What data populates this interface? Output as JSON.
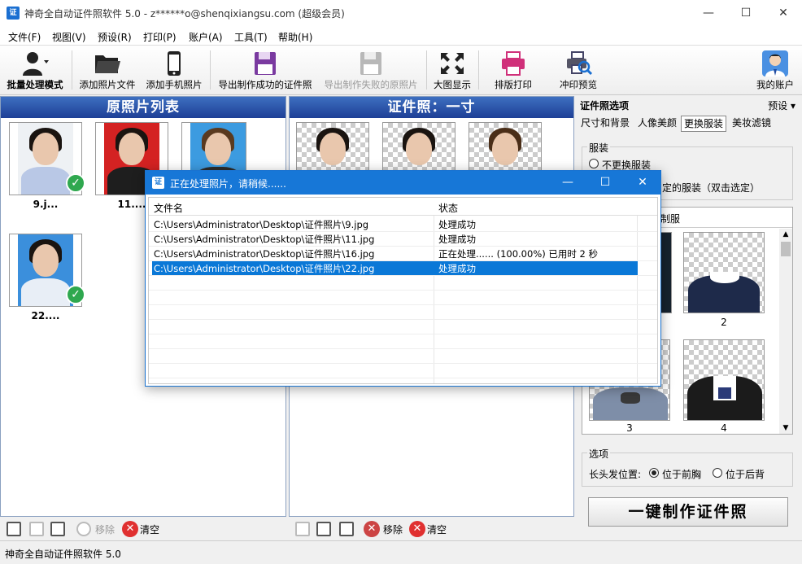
{
  "window": {
    "title": "神奇全自动证件照软件 5.0 - z******o@shenqixiangsu.com (超级会员)",
    "minimize": "—",
    "maximize": "☐",
    "close": "✕"
  },
  "menu": [
    "文件(F)",
    "视图(V)",
    "预设(R)",
    "打印(P)",
    "账户(A)",
    "工具(T)",
    "帮助(H)"
  ],
  "toolbar": {
    "batch": "批量处理模式",
    "add_file": "添加照片文件",
    "add_phone": "添加手机照片",
    "export_success": "导出制作成功的证件照",
    "export_failed": "导出制作失败的原照片",
    "big_view": "大图显示",
    "layout_print": "排版打印",
    "print_preview": "冲印预览",
    "account": "我的账户"
  },
  "left_panel": {
    "title": "原照片列表",
    "photos": [
      "9.j...",
      "11....",
      "22...."
    ],
    "remove": "移除",
    "clear": "清空"
  },
  "middle_panel": {
    "title": "证件照：一寸",
    "remove": "移除",
    "clear": "清空"
  },
  "right_panel": {
    "title": "证件照选项",
    "preset": "预设",
    "tabs": [
      "尺寸和背景",
      "人像美颜",
      "更换服装",
      "美妆滤镜"
    ],
    "clothing_group": "服装",
    "no_change": "不更换服装",
    "selected_suffix": "定的服装（双击选定）",
    "uniform_tab": "制服",
    "clothes_labels": [
      "2",
      "3",
      "4"
    ],
    "options_group": "选项",
    "long_hair_label": "长头发位置:",
    "front": "位于前胸",
    "back": "位于后背",
    "make_button": "一键制作证件照"
  },
  "dialog": {
    "title": "正在处理照片，请稍候......",
    "col_file": "文件名",
    "col_status": "状态",
    "rows": [
      {
        "file": "C:\\Users\\Administrator\\Desktop\\证件照片\\9.jpg",
        "status": "处理成功"
      },
      {
        "file": "C:\\Users\\Administrator\\Desktop\\证件照片\\11.jpg",
        "status": "处理成功"
      },
      {
        "file": "C:\\Users\\Administrator\\Desktop\\证件照片\\16.jpg",
        "status": "正在处理...... (100.00%) 已用时 2 秒"
      },
      {
        "file": "C:\\Users\\Administrator\\Desktop\\证件照片\\22.jpg",
        "status": "处理成功"
      }
    ]
  },
  "status_bar": "神奇全自动证件照软件 5.0"
}
